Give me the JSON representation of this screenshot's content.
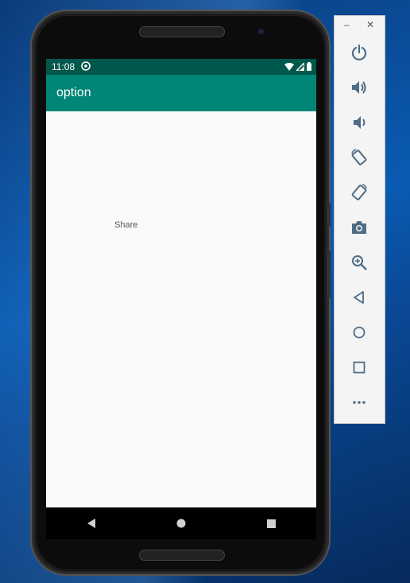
{
  "status_bar": {
    "time": "11:08"
  },
  "app_bar": {
    "title": "option"
  },
  "content": {
    "share_label": "Share"
  },
  "toolbar": {
    "minimize": "–",
    "close": "✕",
    "buttons": [
      {
        "icon": "power-icon"
      },
      {
        "icon": "volume-up-icon"
      },
      {
        "icon": "volume-down-icon"
      },
      {
        "icon": "rotate-left-icon"
      },
      {
        "icon": "rotate-right-icon"
      },
      {
        "icon": "camera-icon"
      },
      {
        "icon": "zoom-icon"
      },
      {
        "icon": "back-icon"
      },
      {
        "icon": "home-icon"
      },
      {
        "icon": "overview-icon"
      },
      {
        "icon": "more-icon"
      }
    ]
  },
  "colors": {
    "status_bar": "#00574b",
    "app_bar": "#008577",
    "screen_bg": "#fafafa",
    "toolbar_icon": "#4f6c86"
  }
}
